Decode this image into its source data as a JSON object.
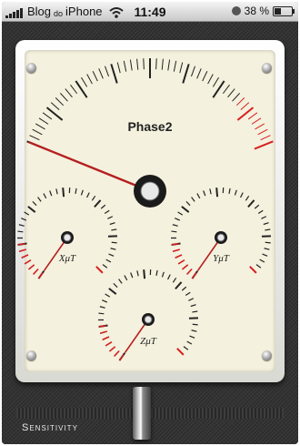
{
  "status_bar": {
    "carrier": "Blog",
    "carrier_small": "do",
    "carrier_device": "iPhone",
    "time": "11:49",
    "battery": "38 %",
    "battery_level": 0.38
  },
  "meter": {
    "title": "Phase2",
    "main_needle_level": 0.0,
    "subdials": [
      {
        "label": "XμT",
        "needle_level": 0.0
      },
      {
        "label": "YμT",
        "needle_level": 0.0
      },
      {
        "label": "ZμT",
        "needle_level": 0.0
      }
    ]
  },
  "sensitivity": {
    "label": "Sensitivity",
    "level": 0.5
  },
  "colors": {
    "dial_face": "#f4f1de",
    "tick": "#222222",
    "red_zone": "#d62020",
    "needle": "#b51f1f",
    "leather": "#353535"
  }
}
